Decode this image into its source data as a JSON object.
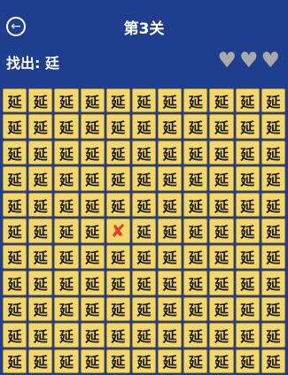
{
  "header": {
    "back_icon": "back-arrow-icon",
    "back_glyph": "←",
    "title": "第3关"
  },
  "find": {
    "label": "找出:",
    "target": "廷"
  },
  "hearts": {
    "count": 3,
    "icon": "heart-icon",
    "glyph": "♥",
    "color": "#a9a9a9"
  },
  "grid": {
    "rows": 11,
    "cols": 11,
    "default_char": "延",
    "colors": {
      "cell": "#f3d76b",
      "mark": "#e53b2a"
    },
    "marked": {
      "row": 5,
      "col": 4,
      "glyph": "✘"
    }
  }
}
